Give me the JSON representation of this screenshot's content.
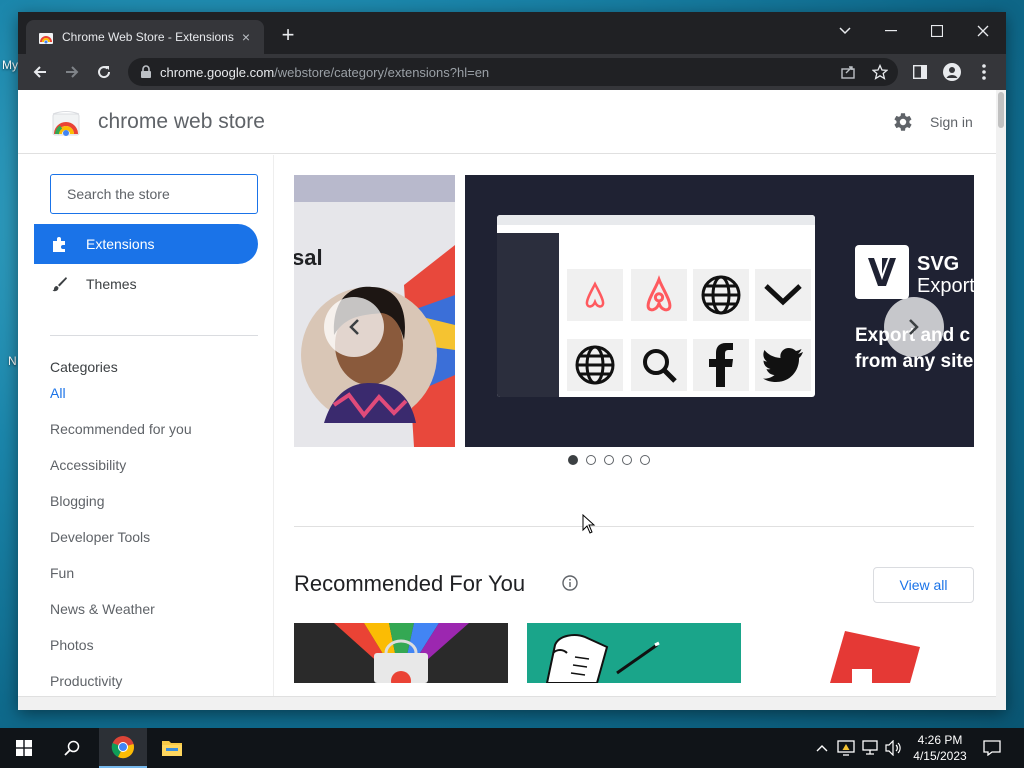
{
  "desktop": {
    "labels": [
      "My",
      "N"
    ]
  },
  "browser": {
    "tab": {
      "title": "Chrome Web Store - Extensions",
      "close_icon": "×"
    },
    "new_tab": "+",
    "controls": {
      "dropdown": "⌄",
      "minimize": "—",
      "maximize": "☐",
      "close": "✕"
    },
    "address": {
      "host": "chrome.google.com",
      "path": "/webstore/category/extensions?hl=en"
    }
  },
  "store": {
    "name": "chrome web store",
    "sign_in": "Sign in",
    "search_placeholder": "Search the store",
    "nav": [
      {
        "label": "Extensions",
        "icon": "puzzle-icon",
        "active": true
      },
      {
        "label": "Themes",
        "icon": "brush-icon",
        "active": false
      }
    ],
    "categories_title": "Categories",
    "categories": [
      "All",
      "Recommended for you",
      "Accessibility",
      "Blogging",
      "Developer Tools",
      "Fun",
      "News & Weather",
      "Photos",
      "Productivity"
    ],
    "carousel": {
      "left_fragment": "sal",
      "svg_badge": "SVG",
      "svg_badge_sub": "Export",
      "tagline_line1": "Export and c",
      "tagline_line2": "from any site",
      "dots": 5,
      "active_dot": 0
    },
    "recommended": {
      "title": "Recommended For You",
      "view_all": "View all"
    }
  },
  "taskbar": {
    "time": "4:26 PM",
    "date": "4/15/2023"
  },
  "colors": {
    "accent": "#1a73e8",
    "chrome_dark": "#202124",
    "slide_dark": "#1f2233"
  }
}
